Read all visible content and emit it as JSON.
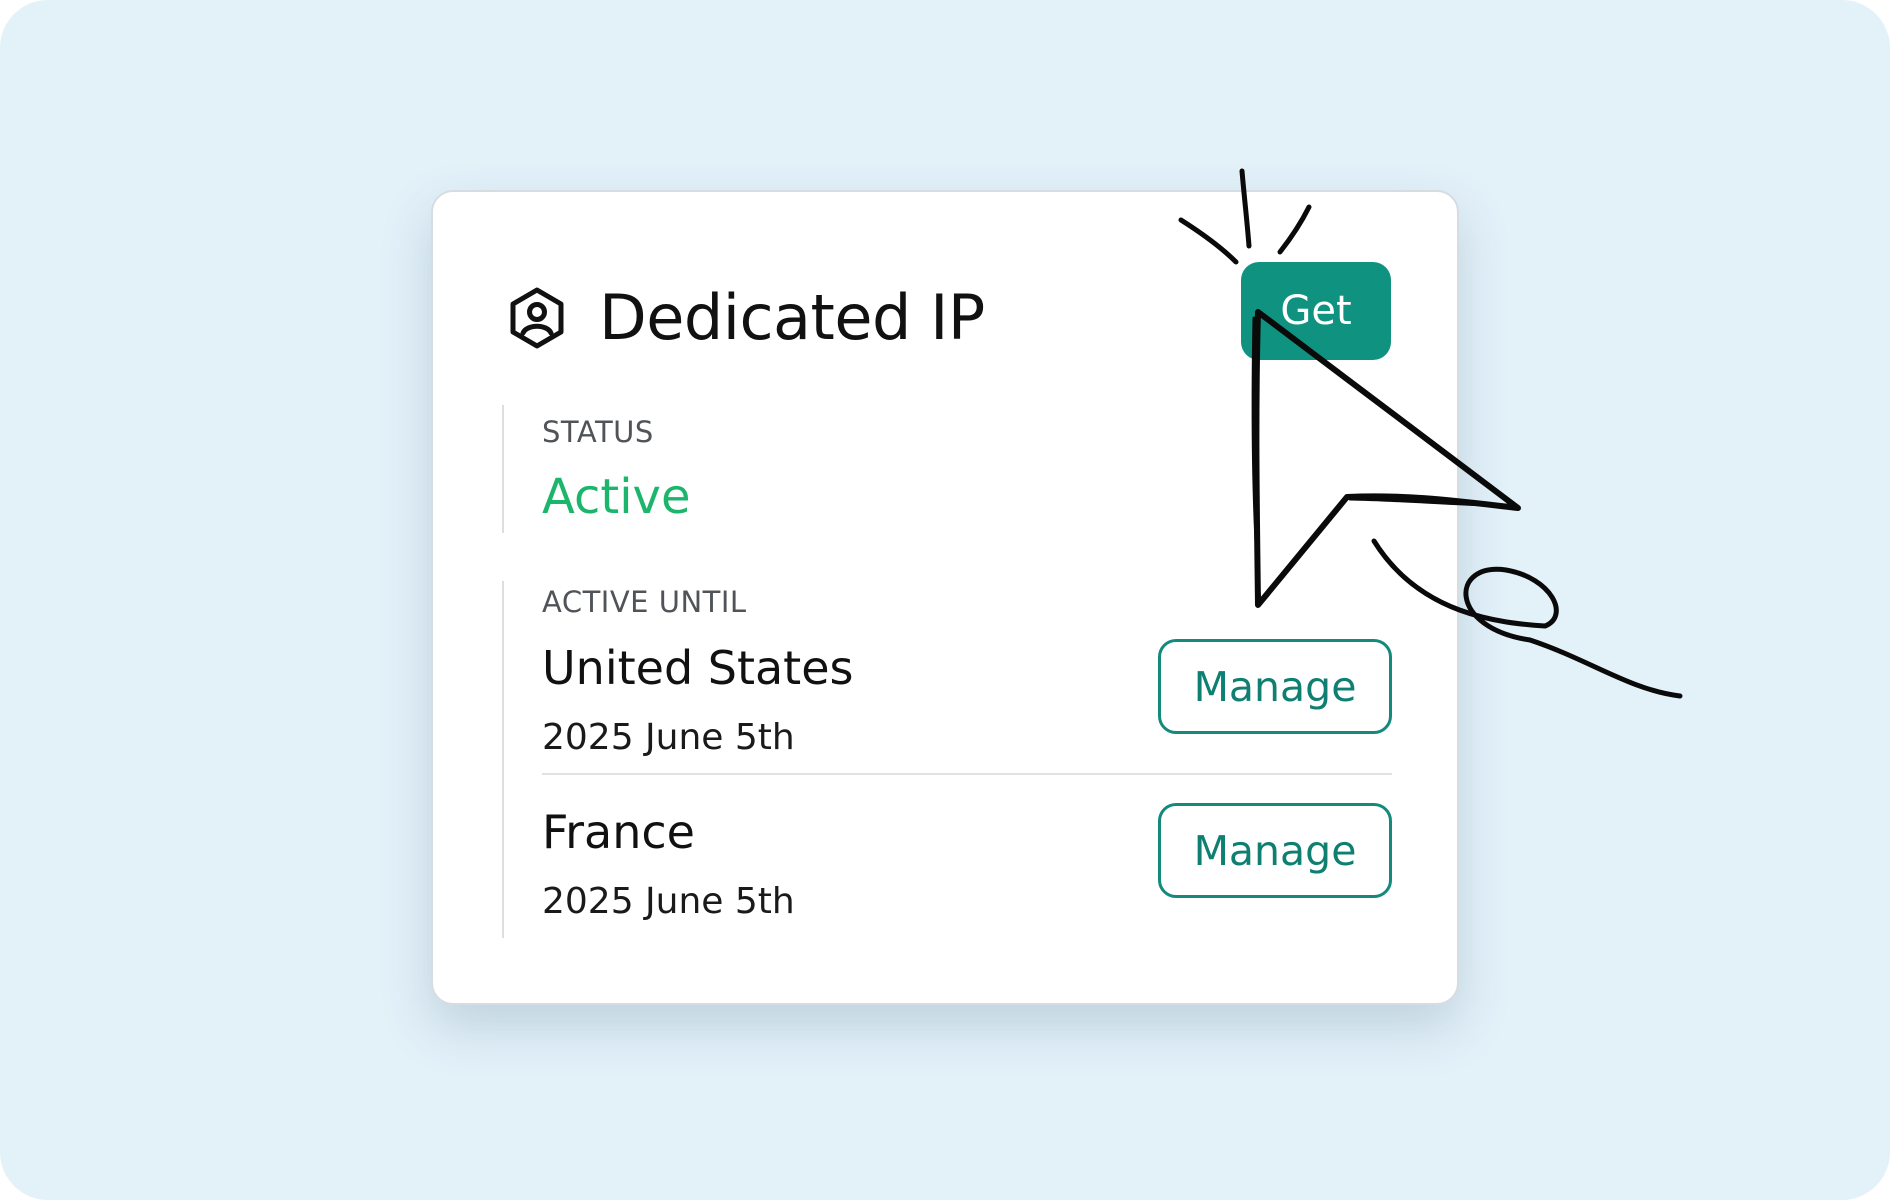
{
  "card": {
    "title": "Dedicated IP",
    "title_icon": "dedicated-ip-icon",
    "get_button_label": "Get",
    "status": {
      "label": "STATUS",
      "value": "Active",
      "value_color": "#1bb66c"
    },
    "active_until": {
      "label": "ACTIVE UNTIL",
      "locations": [
        {
          "country": "United States",
          "date": "2025 June 5th",
          "action_label": "Manage"
        },
        {
          "country": "France",
          "date": "2025 June 5th",
          "action_label": "Manage"
        }
      ]
    }
  },
  "colors": {
    "background": "#e3f1f9",
    "accent": "#0f9380",
    "manage_text": "#0f7f72"
  },
  "decoration": {
    "cursor_icon": "hand-drawn-cursor-icon"
  }
}
